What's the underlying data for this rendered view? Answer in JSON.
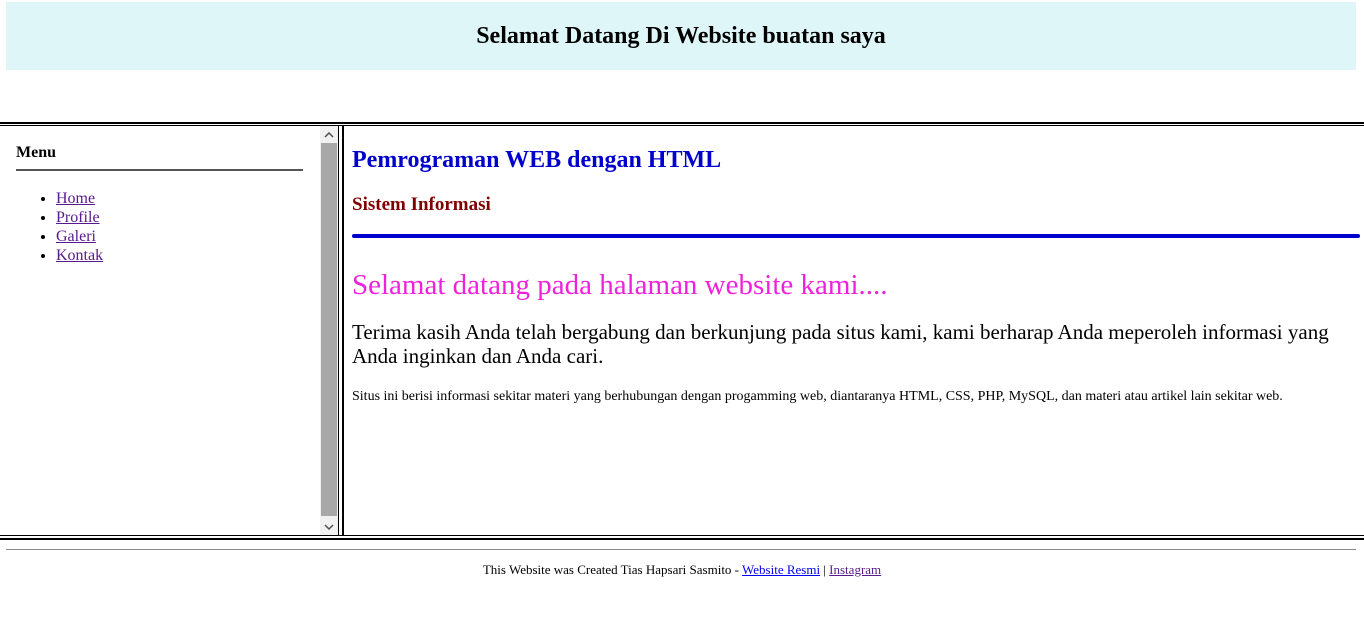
{
  "header": {
    "title": "Selamat Datang Di Website buatan saya",
    "background": "#dff6f8"
  },
  "sidebar": {
    "title": "Menu",
    "items": [
      {
        "label": "Home"
      },
      {
        "label": "Profile"
      },
      {
        "label": "Galeri"
      },
      {
        "label": "Kontak"
      }
    ]
  },
  "main": {
    "title": "Pemrograman WEB dengan HTML",
    "subtitle": "Sistem Informasi",
    "welcome": "Selamat datang pada halaman website kami....",
    "paragraph_1": "Terima kasih Anda telah bergabung dan berkunjung pada situs kami, kami berharap Anda meperoleh informasi yang Anda inginkan dan Anda cari.",
    "paragraph_2": "Situs ini berisi informasi sekitar materi yang berhubungan dengan progamming web, diantaranya HTML, CSS, PHP, MySQL, dan materi atau artikel lain sekitar web.",
    "colors": {
      "title": "#0000cd",
      "subtitle": "#800000",
      "rule": "#0000cd",
      "welcome": "#ee22dd"
    }
  },
  "footer": {
    "text": "This Website was Created Tias Hapsari Sasmito - ",
    "link_official": "Website Resmi",
    "separator": " | ",
    "link_instagram": "Instagram"
  },
  "icons": {
    "scroll_up": "chevron-up-icon",
    "scroll_down": "chevron-down-icon"
  }
}
